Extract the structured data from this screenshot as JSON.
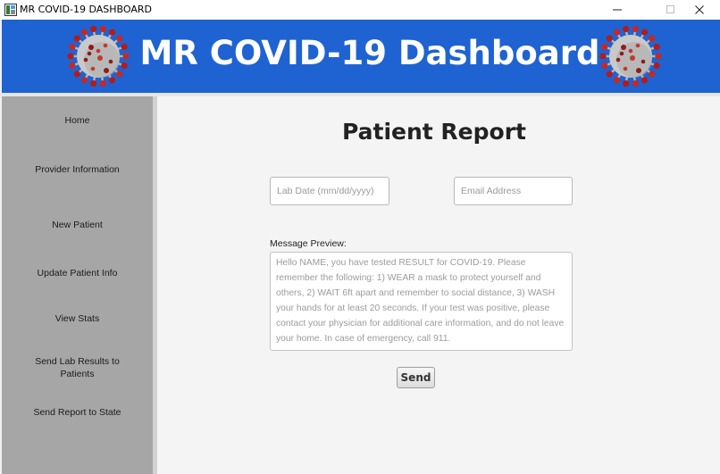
{
  "window": {
    "title": "MR COVID-19 DASHBOARD",
    "controls": {
      "minimize": "—",
      "maximize": "☐",
      "close": "✕"
    }
  },
  "header": {
    "title": "MR COVID-19 Dashboard",
    "background_color": "#1e63d1",
    "left_image_icon": "coronavirus-icon",
    "right_image_icon": "coronavirus-icon"
  },
  "sidebar": {
    "background_color": "#a6a6a6",
    "items": [
      {
        "label": "Home"
      },
      {
        "label": "Provider Information"
      },
      {
        "label": "New Patient"
      },
      {
        "label": "Update Patient Info"
      },
      {
        "label": "View Stats"
      },
      {
        "label": "Send Lab Results to\nPatients"
      },
      {
        "label": "Send Report to State"
      }
    ]
  },
  "main": {
    "title": "Patient Report",
    "lab_date": {
      "value": "",
      "placeholder": "Lab Date (mm/dd/yyyy)"
    },
    "email": {
      "value": "",
      "placeholder": "Email Address"
    },
    "preview_label": "Message Preview:",
    "preview_text": "Hello NAME, you have tested RESULT for COVID-19. Please remember the following: 1) WEAR a mask to protect yourself and others, 2) WAIT 6ft apart and remember to social distance, 3) WASH your hands for at least 20 seconds.  If your test was positive, please contact your physician for additional care information, and do not leave your home. In case of emergency, call 911.",
    "send_label": "Send"
  }
}
